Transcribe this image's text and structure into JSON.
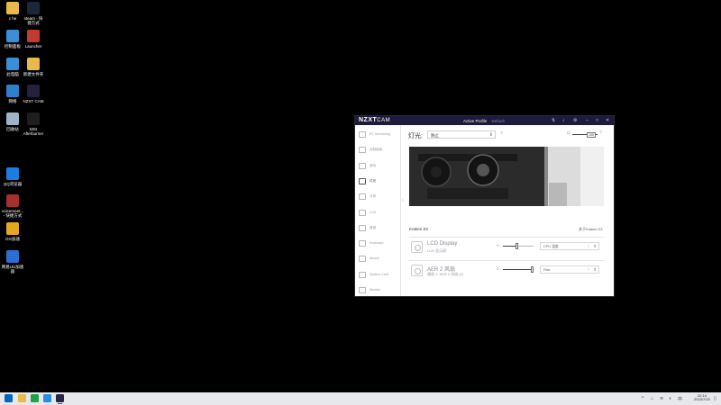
{
  "desktop": {
    "icons": [
      {
        "name": "folder-icon",
        "label": "c he",
        "color": "#e9b94a"
      },
      {
        "name": "steam-icon",
        "label": "steam - 快\n捷方式",
        "color": "#1b2838"
      },
      {
        "name": "control-panel-icon",
        "label": "控制面板",
        "color": "#3a8fd6"
      },
      {
        "name": "launcher-icon",
        "label": "Launcher",
        "color": "#c23b30"
      },
      {
        "name": "computer-icon",
        "label": "此电脑",
        "color": "#3a8fd6"
      },
      {
        "name": "folder-icon-2",
        "label": "新建文件夹",
        "color": "#e9b94a"
      },
      {
        "name": "network-icon",
        "label": "网络",
        "color": "#2f7fcf"
      },
      {
        "name": "nzxt-cam-icon",
        "label": "NZXT CAM",
        "color": "#26213f"
      },
      {
        "name": "recycle-bin-icon",
        "label": "回收站",
        "color": "#9fb3c9"
      },
      {
        "name": "msi-afterburner-icon",
        "label": "MSI\nAfterburner",
        "color": "#1e1e1e"
      },
      {
        "name": "browser-icon",
        "label": "QQ浏览器",
        "color": "#1a7de0"
      },
      {
        "name": "voicemeeter-icon",
        "label": "voicemeet...\n- 快捷方式",
        "color": "#a53030"
      },
      {
        "name": "game-icon",
        "label": "GG加速",
        "color": "#e4a820"
      },
      {
        "name": "netease-icon",
        "label": "网易UU加速\n器",
        "color": "#2b6fd1"
      }
    ]
  },
  "window": {
    "logo_main": "NZXT",
    "logo_sub": "CAM",
    "active_profile_label": "Active Profile",
    "active_profile_value": "Default",
    "sidebar": [
      {
        "label": "PC Monitoring",
        "name": "nav-pc-monitoring"
      },
      {
        "label": "控制面板",
        "name": "nav-control"
      },
      {
        "label": "游戏",
        "name": "nav-games"
      },
      {
        "label": "灯光",
        "name": "nav-lighting",
        "active": true
      },
      {
        "label": "冷却",
        "name": "nav-cooling"
      },
      {
        "label": "LCD",
        "name": "nav-lcd"
      },
      {
        "label": "音频",
        "name": "nav-audio"
      },
      {
        "label": "Keyboard",
        "name": "nav-keyboard"
      },
      {
        "label": "Mouse",
        "name": "nav-mouse"
      },
      {
        "label": "System Card",
        "name": "nav-system-card"
      },
      {
        "label": "Monitor",
        "name": "nav-monitor"
      }
    ],
    "lighting_label": "灯光:",
    "lighting_select": "防止",
    "global_brightness": {
      "value": "100",
      "fill": 1.0
    },
    "device_name": "Kraken Z3",
    "device_link": "关于Kraken Z3",
    "rows": [
      {
        "name": "lcd-display",
        "title": "LCD Display",
        "sub": "LCD 显示屏",
        "brightness": 0.45,
        "select": "CPU 温度"
      },
      {
        "name": "aer2-fan",
        "title": "AER 2 风扇",
        "sub": "通道 1: AER 2 风扇 (2)",
        "brightness": 0.95,
        "select": "Rise"
      }
    ]
  },
  "taskbar": {
    "clock_time": "22:14",
    "clock_date": "2023/7/20"
  },
  "colors": {
    "titlebar": "#1d1b3b",
    "taskbar": "#e7e8ec"
  }
}
